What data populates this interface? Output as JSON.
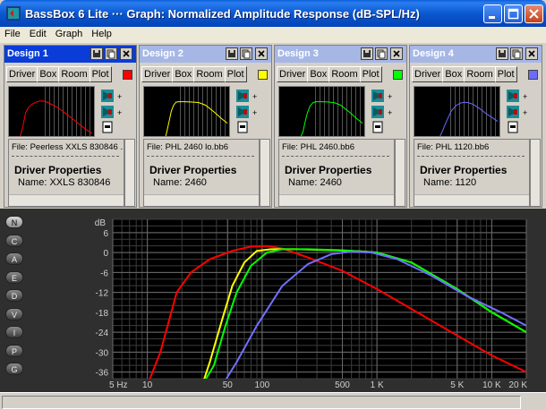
{
  "window": {
    "title": "BassBox 6 Lite ··· Graph: Normalized Amplitude Response (dB-SPL/Hz)"
  },
  "menu": [
    "File",
    "Edit",
    "Graph",
    "Help"
  ],
  "designs": [
    {
      "title": "Design 1",
      "tabs": [
        "Driver",
        "Box",
        "Room",
        "Plot"
      ],
      "color": "#ff0000",
      "file": "File: Peerless XXLS 830846 ...",
      "props_label": "Driver Properties",
      "name": "Name: XXLS 830846",
      "active": true
    },
    {
      "title": "Design 2",
      "tabs": [
        "Driver",
        "Box",
        "Room",
        "Plot"
      ],
      "color": "#ffff00",
      "file": "File: PHL 2460 lo.bb6",
      "props_label": "Driver Properties",
      "name": "Name: 2460",
      "active": false
    },
    {
      "title": "Design 3",
      "tabs": [
        "Driver",
        "Box",
        "Room",
        "Plot"
      ],
      "color": "#00ff00",
      "file": "File: PHL 2460.bb6",
      "props_label": "Driver Properties",
      "name": "Name: 2460",
      "active": false
    },
    {
      "title": "Design 4",
      "tabs": [
        "Driver",
        "Box",
        "Room",
        "Plot"
      ],
      "color": "#6b6bff",
      "file": "File: PHL 1120.bb6",
      "props_label": "Driver Properties",
      "name": "Name: 1120",
      "active": false
    }
  ],
  "side_buttons": [
    "N",
    "C",
    "A",
    "E",
    "D",
    "V",
    "I",
    "P",
    "G"
  ],
  "side_buttons_active": "N",
  "chart_data": {
    "type": "line",
    "ylabel": "dB",
    "xscale": "log",
    "xlim": [
      5,
      20000
    ],
    "ylim": [
      -38,
      10
    ],
    "yticks": [
      6,
      0,
      -6,
      -12,
      -18,
      -24,
      -30,
      -36
    ],
    "xticks": [
      {
        "v": 5,
        "label": "5 Hz"
      },
      {
        "v": 10,
        "label": "10"
      },
      {
        "v": 50,
        "label": "50"
      },
      {
        "v": 100,
        "label": "100"
      },
      {
        "v": 500,
        "label": "500"
      },
      {
        "v": 1000,
        "label": "1 K"
      },
      {
        "v": 5000,
        "label": "5 K"
      },
      {
        "v": 10000,
        "label": "10 K"
      },
      {
        "v": 20000,
        "label": "20 K"
      }
    ],
    "grid": true,
    "series": [
      {
        "color": "#ff0000",
        "points": [
          [
            10,
            -40
          ],
          [
            13,
            -30
          ],
          [
            18,
            -12
          ],
          [
            24,
            -6
          ],
          [
            35,
            -2
          ],
          [
            55,
            0.5
          ],
          [
            80,
            1.8
          ],
          [
            110,
            2
          ],
          [
            150,
            1.2
          ],
          [
            250,
            -1.5
          ],
          [
            500,
            -5.5
          ],
          [
            1000,
            -11
          ],
          [
            2000,
            -17
          ],
          [
            5000,
            -25
          ],
          [
            10000,
            -31
          ],
          [
            20000,
            -36
          ]
        ]
      },
      {
        "color": "#ffff00",
        "points": [
          [
            30,
            -40
          ],
          [
            35,
            -33
          ],
          [
            45,
            -20
          ],
          [
            55,
            -10
          ],
          [
            70,
            -3
          ],
          [
            90,
            0.5
          ],
          [
            120,
            1
          ],
          [
            200,
            1
          ],
          [
            400,
            0.7
          ],
          [
            700,
            0.4
          ],
          [
            1000,
            0
          ],
          [
            2000,
            -3
          ],
          [
            5000,
            -11
          ],
          [
            10000,
            -18
          ],
          [
            20000,
            -24
          ]
        ]
      },
      {
        "color": "#00ff00",
        "points": [
          [
            30,
            -40
          ],
          [
            38,
            -34
          ],
          [
            48,
            -22
          ],
          [
            60,
            -12
          ],
          [
            80,
            -4
          ],
          [
            110,
            0
          ],
          [
            150,
            1
          ],
          [
            250,
            1
          ],
          [
            500,
            0.7
          ],
          [
            1000,
            0
          ],
          [
            2000,
            -3
          ],
          [
            5000,
            -11
          ],
          [
            10000,
            -18
          ],
          [
            20000,
            -24
          ]
        ]
      },
      {
        "color": "#7070ff",
        "points": [
          [
            45,
            -40
          ],
          [
            60,
            -33
          ],
          [
            90,
            -22
          ],
          [
            150,
            -10
          ],
          [
            250,
            -3.5
          ],
          [
            400,
            -0.5
          ],
          [
            600,
            0.3
          ],
          [
            900,
            0
          ],
          [
            1500,
            -2
          ],
          [
            3000,
            -7
          ],
          [
            6000,
            -13
          ],
          [
            12000,
            -18
          ],
          [
            20000,
            -22
          ]
        ]
      }
    ]
  }
}
